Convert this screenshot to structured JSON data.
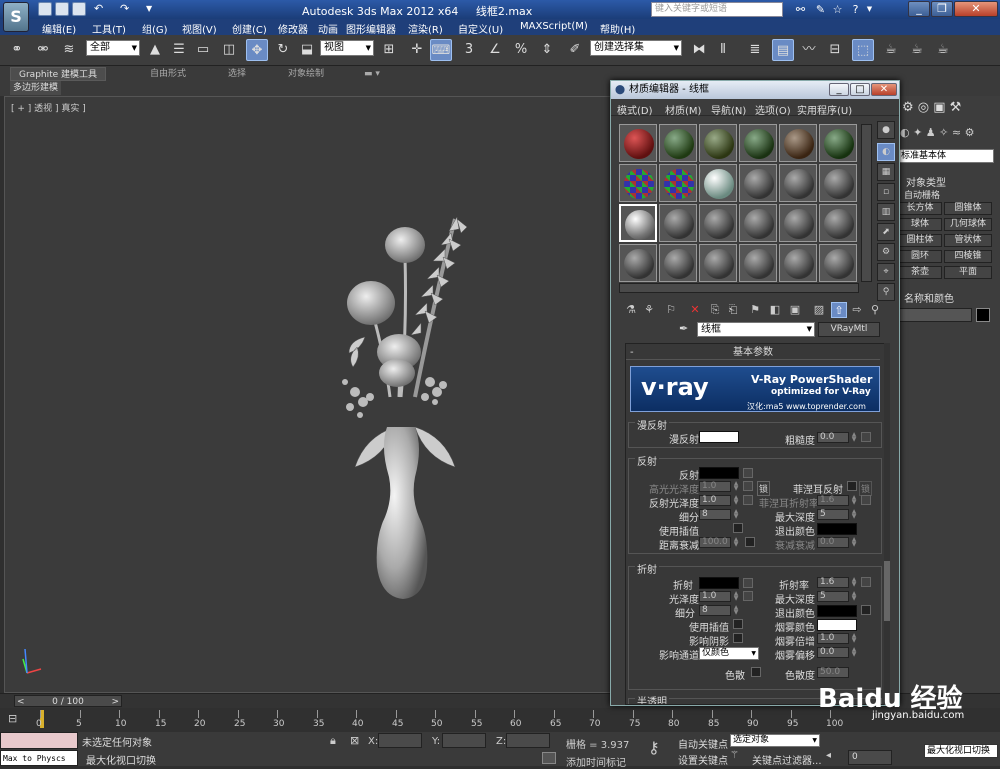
{
  "app": {
    "title": "Autodesk 3ds Max  2012 x64",
    "filename": "线框2.max",
    "search_placeholder": "键入关键字或短语"
  },
  "menubar": [
    "编辑(E)",
    "工具(T)",
    "组(G)",
    "视图(V)",
    "创建(C)",
    "修改器",
    "动画",
    "图形编辑器",
    "渲染(R)",
    "自定义(U)",
    "MAXScript(M)",
    "帮助(H)"
  ],
  "toolbar": {
    "selection_filter": "全部",
    "ref_coord": "视图",
    "named_selection": "创建选择集"
  },
  "ribbon": {
    "tabs": [
      "Graphite 建模工具",
      "自由形式",
      "选择",
      "对象绘制"
    ],
    "sub": "多边形建模"
  },
  "viewport": {
    "label": "[ + ] 透视 ] 真实 ]"
  },
  "command_panel": {
    "category": "标准基本体",
    "rollout_object_type": "对象类型",
    "autogrid": "自动栅格",
    "buttons": [
      "长方体",
      "圆锥体",
      "球体",
      "几何球体",
      "圆柱体",
      "管状体",
      "圆环",
      "四棱锥",
      "茶壶",
      "平面"
    ],
    "rollout_name_color": "名称和颜色"
  },
  "timeline": {
    "frame": "0 / 100",
    "ticks": [
      "0",
      "5",
      "10",
      "15",
      "20",
      "25",
      "30",
      "35",
      "40",
      "45",
      "50",
      "55",
      "60",
      "65",
      "70",
      "75",
      "80",
      "85",
      "90",
      "95",
      "100"
    ]
  },
  "status": {
    "listener": "Max to Physcs",
    "selected": "未选定任何对象",
    "prompt": "最大化视口切换",
    "x_label": "X:",
    "y_label": "Y:",
    "z_label": "Z:",
    "grid": "栅格 = 3.937",
    "add_time_tag": "添加时间标记",
    "auto_key": "自动关键点",
    "set_key": "设置关键点",
    "selected_mode": "选定对象",
    "key_filters": "关键点过滤器...",
    "frame_value": "0",
    "tooltip": "最大化视口切换"
  },
  "material_editor": {
    "title": "材质编辑器 - 线框",
    "menu": [
      "模式(D)",
      "材质(M)",
      "导航(N)",
      "选项(O)",
      "实用程序(U)"
    ],
    "material_name": "线框",
    "material_type": "VRayMtl",
    "rollout_title": "基本参数",
    "banner": {
      "logo": "v·ray",
      "product": "V-Ray PowerShader",
      "tagline": "optimized for V-Ray",
      "credit": "汉化:ma5 www.toprender.com"
    },
    "diffuse": {
      "group": "漫反射",
      "label": "漫反射",
      "roughness_label": "粗糙度",
      "roughness": "0.0"
    },
    "reflection": {
      "group": "反射",
      "label": "反射",
      "hilight_gloss_label": "高光光泽度",
      "hilight_gloss": "1.0",
      "lock": "锁",
      "fresnel_label": "菲涅耳反射",
      "refl_gloss_label": "反射光泽度",
      "refl_gloss": "1.0",
      "fresnel_ior_label": "菲涅耳折射率",
      "fresnel_ior": "1.6",
      "subdivs_label": "细分",
      "subdivs": "8",
      "max_depth_label": "最大深度",
      "max_depth": "5",
      "use_interp_label": "使用插值",
      "exit_color_label": "退出颜色",
      "dim_distance_label": "距离衰减",
      "dim_distance": "100.0",
      "dim_falloff_label": "衰减衰减",
      "dim_falloff": "0.0"
    },
    "refraction": {
      "group": "折射",
      "label": "折射",
      "ior_label": "折射率",
      "ior": "1.6",
      "gloss_label": "光泽度",
      "gloss": "1.0",
      "max_depth_label": "最大深度",
      "max_depth": "5",
      "subdivs_label": "细分",
      "subdivs": "8",
      "exit_color_label": "退出颜色",
      "use_interp_label": "使用插值",
      "fog_color_label": "烟雾颜色",
      "affect_shadows_label": "影响阴影",
      "fog_mult_label": "烟雾倍增",
      "fog_mult": "1.0",
      "affect_channels_label": "影响通道",
      "affect_channels": "仅颜色",
      "fog_bias_label": "烟雾偏移",
      "fog_bias": "0.0",
      "dispersion_label": "色散",
      "abbe_label": "色散度",
      "abbe": "50.0"
    },
    "translucency": {
      "group": "半透明"
    }
  },
  "watermark": {
    "brand": "Baidu 经验",
    "url": "jingyan.baidu.com"
  }
}
